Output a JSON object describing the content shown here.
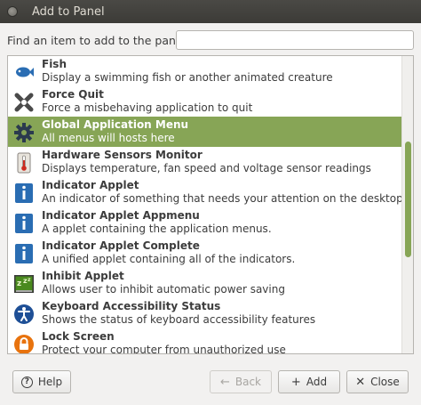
{
  "window": {
    "title": "Add to Panel"
  },
  "search": {
    "label": "Find an item to add to the panel:",
    "value": "",
    "placeholder": ""
  },
  "items": [
    {
      "icon": "fish-icon",
      "name": "Fish",
      "description": "Display a swimming fish or another animated creature"
    },
    {
      "icon": "force-quit-icon",
      "name": "Force Quit",
      "description": "Force a misbehaving application to quit"
    },
    {
      "icon": "gear-icon",
      "name": "Global Application Menu",
      "description": "All menus will hosts here",
      "selected": true
    },
    {
      "icon": "thermometer-icon",
      "name": "Hardware Sensors Monitor",
      "description": "Displays temperature, fan speed and voltage sensor readings"
    },
    {
      "icon": "info-icon",
      "name": "Indicator Applet",
      "description": "An indicator of something that needs your attention on the desktop"
    },
    {
      "icon": "info-icon",
      "name": "Indicator Applet Appmenu",
      "description": "A applet containing the application menus."
    },
    {
      "icon": "info-icon",
      "name": "Indicator Applet Complete",
      "description": "A unified applet containing all of the indicators."
    },
    {
      "icon": "inhibit-icon",
      "name": "Inhibit Applet",
      "description": "Allows user to inhibit automatic power saving"
    },
    {
      "icon": "accessibility-icon",
      "name": "Keyboard Accessibility Status",
      "description": "Shows the status of keyboard accessibility features"
    },
    {
      "icon": "lock-icon",
      "name": "Lock Screen",
      "description": "Protect your computer from unauthorized use"
    }
  ],
  "buttons": {
    "help": "Help",
    "back": "Back",
    "add": "Add",
    "close": "Close"
  },
  "colors": {
    "selection": "#87a556",
    "titlebar": "#3c3b37"
  }
}
